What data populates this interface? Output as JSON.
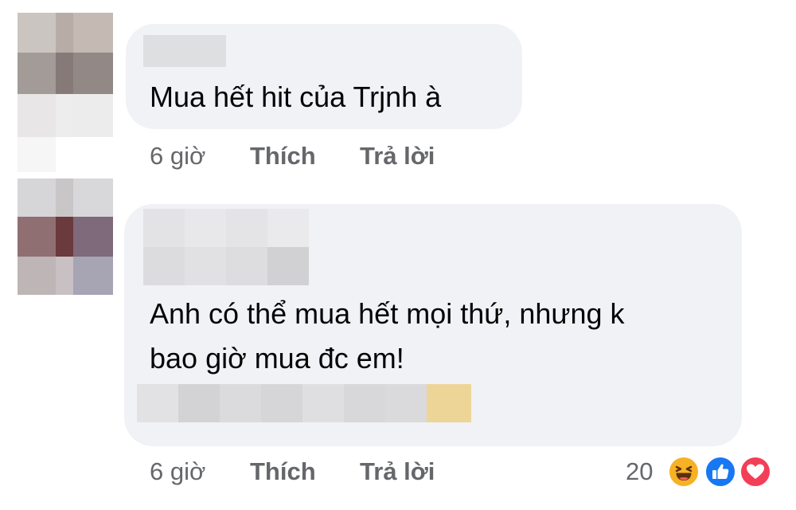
{
  "comments": [
    {
      "text": "Mua hết hit của Trjnh à",
      "time": "6 giờ",
      "like_label": "Thích",
      "reply_label": "Trả lời"
    },
    {
      "text_line1": "Anh có thể mua hết mọi thứ, nhưng k",
      "text_line2": "bao giờ mua đc em!",
      "time": "6 giờ",
      "like_label": "Thích",
      "reply_label": "Trả lời",
      "reaction_count": "20",
      "reactions": [
        "haha-icon",
        "like-icon",
        "love-icon"
      ]
    }
  ],
  "colors": {
    "bubble": "#f0f2f5",
    "meta_text": "#65676b",
    "like_blue": "#1877f2",
    "love_red": "#f33e58",
    "haha_yellow": "#f7b125"
  }
}
